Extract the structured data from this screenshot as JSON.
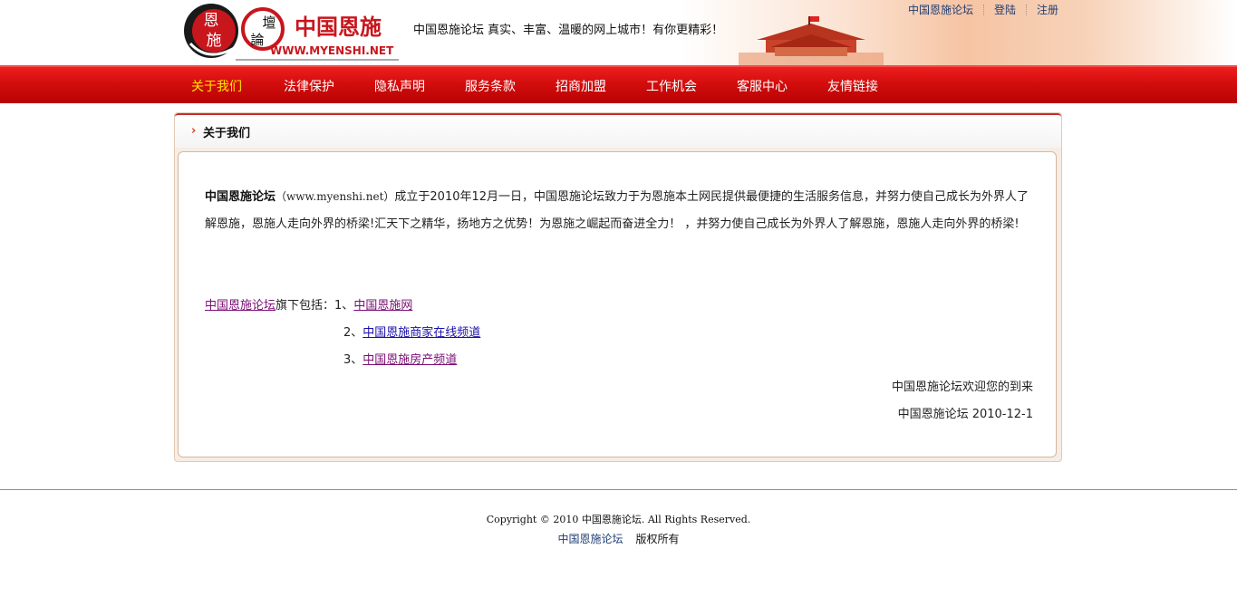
{
  "header": {
    "logo": {
      "seal_chars": [
        "恩",
        "施"
      ],
      "secondary_chars": [
        "壇",
        "論"
      ],
      "brand": "中国恩施",
      "domain": "WWW.MYENSHI.NET"
    },
    "slogan": "中国恩施论坛  真实、丰富、温暖的网上城市！有你更精彩！",
    "top_links": [
      {
        "label": "中国恩施论坛"
      },
      {
        "label": "登陆"
      },
      {
        "label": "注册"
      }
    ]
  },
  "nav": {
    "items": [
      {
        "label": "关于我们",
        "active": true
      },
      {
        "label": "法律保护"
      },
      {
        "label": "隐私声明"
      },
      {
        "label": "服务条款"
      },
      {
        "label": "招商加盟"
      },
      {
        "label": "工作机会"
      },
      {
        "label": "客服中心"
      },
      {
        "label": "友情链接"
      }
    ]
  },
  "panel": {
    "title": "关于我们",
    "intro": {
      "brand": "中国恩施论坛",
      "domain": "（www.myenshi.net）",
      "text": "成立于2010年12月一日，中国恩施论坛致力于为恩施本土网民提供最便捷的生活服务信息，并努力使自己成长为外界人了解恩施，恩施人走向外界的桥梁!汇天下之精华，扬地方之优势！为恩施之崛起而奋进全力！ ，并努力使自己成长为外界人了解恩施，恩施人走向外界的桥梁!"
    },
    "includes": {
      "brand_link": "中国恩施论坛",
      "prefix": "旗下包括：",
      "items": [
        {
          "num": "1、",
          "label": "中国恩施网"
        },
        {
          "num": "2、",
          "label": "中国恩施商家在线频道"
        },
        {
          "num": "3、",
          "label": "中国恩施房产频道"
        }
      ]
    },
    "welcome": "中国恩施论坛欢迎您的到来",
    "signature": "中国恩施论坛  2010-12-1"
  },
  "footer": {
    "copyright": "Copyright © 2010 中国恩施论坛. All Rights Reserved.",
    "links": [
      {
        "label": "中国恩施论坛"
      },
      {
        "label": "版权所有"
      }
    ]
  },
  "colors": {
    "nav_red": "#d30d0d",
    "nav_active": "#ffe400",
    "link_visited": "#7b0e74",
    "link_blue": "#1a0fa8",
    "footer_line": "#e3714f"
  }
}
